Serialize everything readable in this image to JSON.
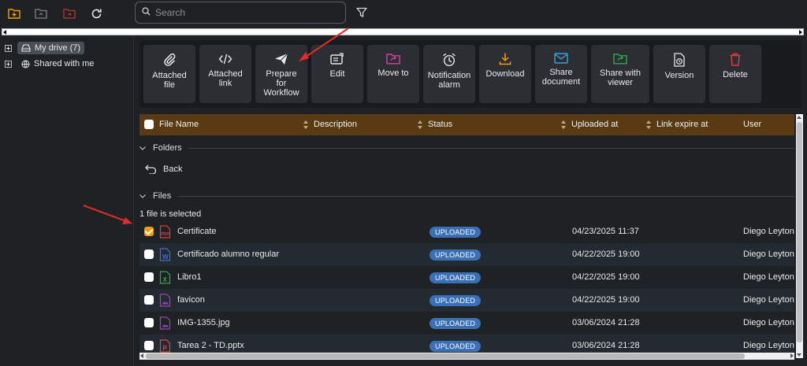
{
  "topbar": {
    "search_placeholder": "Search",
    "icons": [
      "new-folder-icon",
      "upload-folder-icon",
      "move-folder-icon",
      "refresh-icon",
      "search-icon",
      "filter-icon"
    ]
  },
  "sidebar": {
    "items": [
      {
        "label": "My drive (7)",
        "icon": "drive-icon",
        "active": true
      },
      {
        "label": "Shared with me",
        "icon": "globe-icon",
        "active": false
      }
    ]
  },
  "toolbar": {
    "buttons": [
      {
        "label": "Attached\nfile",
        "icon": "paperclip-icon",
        "color": "#e8e8e8"
      },
      {
        "label": "Attached\nlink",
        "icon": "code-link-icon",
        "color": "#e8e8e8"
      },
      {
        "label": "Prepare\nfor\nWorkflow",
        "icon": "paper-plane-icon",
        "color": "#e8e8e8"
      },
      {
        "label": "Edit",
        "icon": "edit-icon",
        "color": "#e8e8e8"
      },
      {
        "label": "Move to",
        "icon": "move-folder-icon",
        "color": "#d63fa6"
      },
      {
        "label": "Notification\nalarm",
        "icon": "alarm-clock-icon",
        "color": "#e8e8e8"
      },
      {
        "label": "Download",
        "icon": "download-icon",
        "color": "#f39c12"
      },
      {
        "label": "Share\ndocument",
        "icon": "envelope-icon",
        "color": "#3aa0d8"
      },
      {
        "label": "Share with\nviewer",
        "icon": "share-folder-icon",
        "color": "#2fa84f"
      },
      {
        "label": "Version",
        "icon": "version-icon",
        "color": "#e8e8e8"
      },
      {
        "label": "Delete",
        "icon": "trash-icon",
        "color": "#e23b3b"
      }
    ]
  },
  "table": {
    "columns": [
      "File Name",
      "Description",
      "Status",
      "Uploaded at",
      "Link expire at",
      "User"
    ],
    "folders_label": "Folders",
    "back_label": "Back",
    "files_label": "Files",
    "selection_text": "1 file is selected",
    "rows": [
      {
        "name": "Certificate",
        "type": "pdf",
        "status": "UPLOADED",
        "uploaded": "04/23/2025 11:37",
        "user": "Diego Leyton E",
        "checked": true
      },
      {
        "name": "Certificado alumno regular",
        "type": "word",
        "status": "UPLOADED",
        "uploaded": "04/22/2025 19:00",
        "user": "Diego Leyton E",
        "checked": false
      },
      {
        "name": "Libro1",
        "type": "excel",
        "status": "UPLOADED",
        "uploaded": "04/22/2025 19:00",
        "user": "Diego Leyton E",
        "checked": false
      },
      {
        "name": "favicon",
        "type": "image",
        "status": "UPLOADED",
        "uploaded": "04/22/2025 19:00",
        "user": "Diego Leyton E",
        "checked": false
      },
      {
        "name": "IMG-1355.jpg",
        "type": "image",
        "status": "UPLOADED",
        "uploaded": "03/06/2024 21:28",
        "user": "Diego Leyton E",
        "checked": false
      },
      {
        "name": "Tarea 2 - TD.pptx",
        "type": "powerpoint",
        "status": "UPLOADED",
        "uploaded": "03/06/2024 21:28",
        "user": "Diego Leyton E",
        "checked": false
      }
    ]
  },
  "colors": {
    "header_bg": "#5a3a12",
    "checkbox_checked": "#f39c12",
    "badge_bg": "#3b6fb6",
    "annotation_arrow": "#e32b2b"
  }
}
